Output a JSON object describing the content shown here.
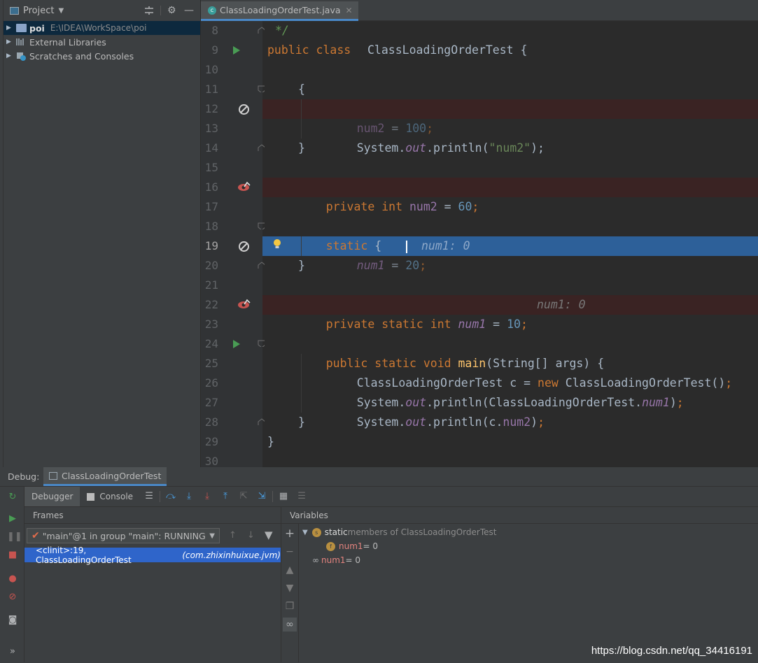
{
  "project_panel": {
    "title": "Project",
    "tree": [
      {
        "name": "poi",
        "path": "E:\\IDEA\\WorkSpace\\poi"
      },
      {
        "name": "External Libraries"
      },
      {
        "name": "Scratches and Consoles"
      }
    ]
  },
  "editor": {
    "tab_label": "ClassLoadingOrderTest.java",
    "tab_icon": "c-class-icon",
    "lines": [
      {
        "n": "8"
      },
      {
        "n": "9"
      },
      {
        "n": "10"
      },
      {
        "n": "11"
      },
      {
        "n": "12"
      },
      {
        "n": "13"
      },
      {
        "n": "14"
      },
      {
        "n": "15"
      },
      {
        "n": "16"
      },
      {
        "n": "17"
      },
      {
        "n": "18"
      },
      {
        "n": "19"
      },
      {
        "n": "20"
      },
      {
        "n": "21"
      },
      {
        "n": "22"
      },
      {
        "n": "23"
      },
      {
        "n": "24"
      },
      {
        "n": "25"
      },
      {
        "n": "26"
      },
      {
        "n": "27"
      },
      {
        "n": "28"
      },
      {
        "n": "29"
      },
      {
        "n": "30"
      }
    ],
    "code": {
      "l8": "*/",
      "l9_kw": "public class",
      "l9_name": "ClassLoadingOrderTest {",
      "l11": "{",
      "l12_a": "num2",
      "l12_b": " = ",
      "l12_c": "100",
      "l12_d": ";",
      "l13_a": "System.",
      "l13_b": "out",
      "l13_c": ".println(",
      "l13_d": "\"num2\"",
      "l13_e": ");",
      "l14": "}",
      "l16_a": "private int ",
      "l16_b": "num2",
      "l16_c": " = ",
      "l16_d": "60",
      "l16_e": ";",
      "l18_a": "static",
      "l18_b": " {",
      "l19_a": "num1",
      "l19_b": " = ",
      "l19_c": "20",
      "l19_d": ";",
      "l19_inline": "num1: 0",
      "l20": "}",
      "l22_a": "private static int ",
      "l22_b": "num1",
      "l22_c": " = ",
      "l22_d": "10",
      "l22_e": ";",
      "l22_inline": "num1: 0",
      "l24_a": "public static void ",
      "l24_b": "main",
      "l24_c": "(String[] args) {",
      "l25_a": "ClassLoadingOrderTest c = ",
      "l25_b": "new",
      "l25_c": " ClassLoadingOrderTest()",
      "l25_d": ";",
      "l26_a": "System.",
      "l26_b": "out",
      "l26_c": ".println(ClassLoadingOrderTest.",
      "l26_d": "num1",
      "l26_e": ")",
      "l26_f": ";",
      "l27_a": "System.",
      "l27_b": "out",
      "l27_c": ".println(c.",
      "l27_d": "num2",
      "l27_e": ")",
      "l27_f": ";",
      "l28": "}",
      "l29": "}"
    }
  },
  "debug": {
    "label": "Debug:",
    "session_tab": "ClassLoadingOrderTest",
    "tabs": {
      "debugger": "Debugger",
      "console": "Console"
    },
    "frames": {
      "title": "Frames",
      "thread": "\"main\"@1 in group \"main\": RUNNING",
      "frame_main": "<clinit>:19, ClassLoadingOrderTest",
      "frame_pkg": "(com.zhixinhuixue.jvm)"
    },
    "variables": {
      "title": "Variables",
      "static_label": "static",
      "static_rest": " members of ClassLoadingOrderTest",
      "static_num1_name": "num1",
      "static_num1_val": " = 0",
      "watch_num1_name": "num1",
      "watch_num1_val": " = 0"
    }
  },
  "watermark": "https://blog.csdn.net/qq_34416191",
  "colors": {
    "selection": "#2f65ca",
    "breakpoint_line": "#3a2323",
    "execution_line": "#2d6099",
    "keyword": "#cc7832",
    "number": "#6897bb",
    "field": "#9876aa"
  }
}
